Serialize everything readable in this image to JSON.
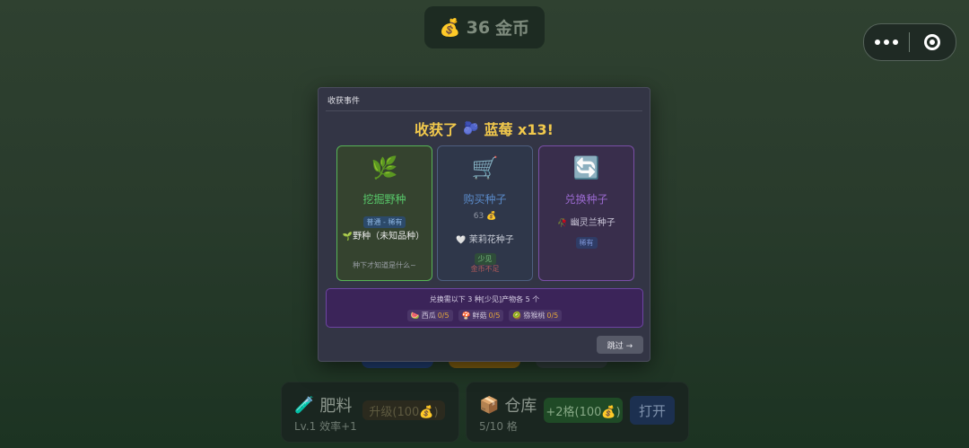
{
  "coins": {
    "icon": "money-bag-icon",
    "amount": "36",
    "unit": "金币",
    "glyph": "💰"
  },
  "capsule": {
    "menu": "more-icon",
    "close": "target-icon"
  },
  "panels": [
    {
      "icon": "🧪",
      "title": "肥料",
      "sub": "Lv.1 效率+1",
      "button": "升级(100💰)"
    },
    {
      "icon": "📦",
      "title": "仓库",
      "sub": "5/10 格",
      "button": "+2格(100💰)",
      "button2": "打开"
    }
  ],
  "modal": {
    "header": "收获事件",
    "headline_prefix": "收获了",
    "headline_icon": "🫐",
    "headline_item": "蓝莓 x13!",
    "options": [
      {
        "icon": "🌿",
        "title": "挖掘野种",
        "tag": "普通 - 稀有",
        "line_icon": "🌱",
        "line": "野种（未知品种）",
        "note": "种下才知道是什么~"
      },
      {
        "icon": "🛒",
        "title": "购买种子",
        "price": "63",
        "price_icon": "💰",
        "line_icon": "🤍",
        "line": "茉莉花种子",
        "tag": "少见",
        "note": "金币不足"
      },
      {
        "icon": "🔄",
        "title": "兑换种子",
        "line_icon": "🥀",
        "line": "幽灵兰种子",
        "tag": "稀有"
      }
    ],
    "requirement": {
      "text": "兑换需以下 3 种[少见]产物各 5 个",
      "items": [
        {
          "icon": "🍉",
          "name": "西瓜",
          "count": "0/5"
        },
        {
          "icon": "🍄",
          "name": "鲜菇",
          "count": "0/5"
        },
        {
          "icon": "🥝",
          "name": "猕猴桃",
          "count": "0/5"
        }
      ]
    },
    "skip": "跳过 →"
  },
  "colors": {
    "gold": "#f2c94c",
    "green": "#58c86a",
    "blue": "#5a8ac8",
    "purple": "#9a69cf"
  }
}
